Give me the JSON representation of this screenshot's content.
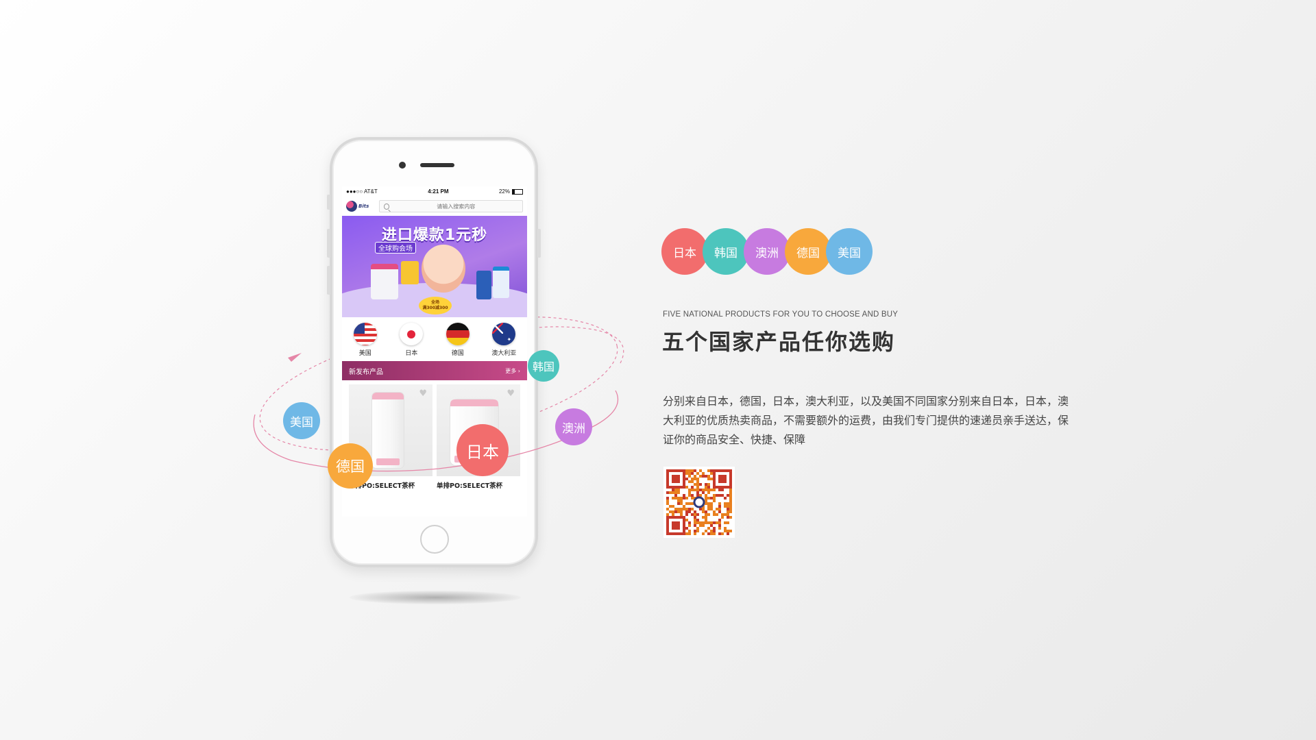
{
  "phone": {
    "statusbar": {
      "carrier": "●●●○○ AT&T",
      "time": "4:21 PM",
      "battery": "22%"
    },
    "appbar": {
      "logo_text": "Bits",
      "search_placeholder": "请输入搜索内容"
    },
    "banner": {
      "title": "进口爆款1元秒",
      "subtitle": "全球购会场",
      "badge_line1": "全场",
      "badge_line2": "满300减300"
    },
    "countries": [
      {
        "label": "美国",
        "flag": "us-flag-icon"
      },
      {
        "label": "日本",
        "flag": "japan-flag-icon"
      },
      {
        "label": "德国",
        "flag": "germany-flag-icon"
      },
      {
        "label": "澳大利亚",
        "flag": "australia-flag-icon"
      }
    ],
    "section": {
      "title": "新发布产品",
      "more": "更多 ›"
    },
    "products": [
      {
        "name": "单排PO:SELECT茶杯"
      },
      {
        "name": "单排PO:SELECT茶杯"
      }
    ]
  },
  "orbit_bubbles": [
    {
      "label": "韩国",
      "color": "#4dc5bd"
    },
    {
      "label": "美国",
      "color": "#6fb8e6"
    },
    {
      "label": "澳洲",
      "color": "#c77be0"
    },
    {
      "label": "德国",
      "color": "#f8a83c"
    },
    {
      "label": "日本",
      "color": "#f26d6d"
    }
  ],
  "tags": [
    {
      "label": "日本",
      "color": "#f26d6d"
    },
    {
      "label": "韩国",
      "color": "#4dc5bd"
    },
    {
      "label": "澳洲",
      "color": "#c77be0"
    },
    {
      "label": "德国",
      "color": "#f8a83c"
    },
    {
      "label": "美国",
      "color": "#6fb8e6"
    }
  ],
  "subtitle_en": "FIVE NATIONAL PRODUCTS FOR YOU TO CHOOSE AND BUY",
  "headline": "五个国家产品任你选购",
  "description": "分别来自日本，德国，日本，澳大利亚，以及美国不同国家分别来自日本，日本，澳大利亚的优质热卖商品，不需要额外的运费，由我们专门提供的速递员亲手送达，保证你的商品安全、快捷、保障",
  "colors": {
    "orbit_line": "#e586a7",
    "headline": "#333333",
    "section_bar": "#b03f7a"
  }
}
